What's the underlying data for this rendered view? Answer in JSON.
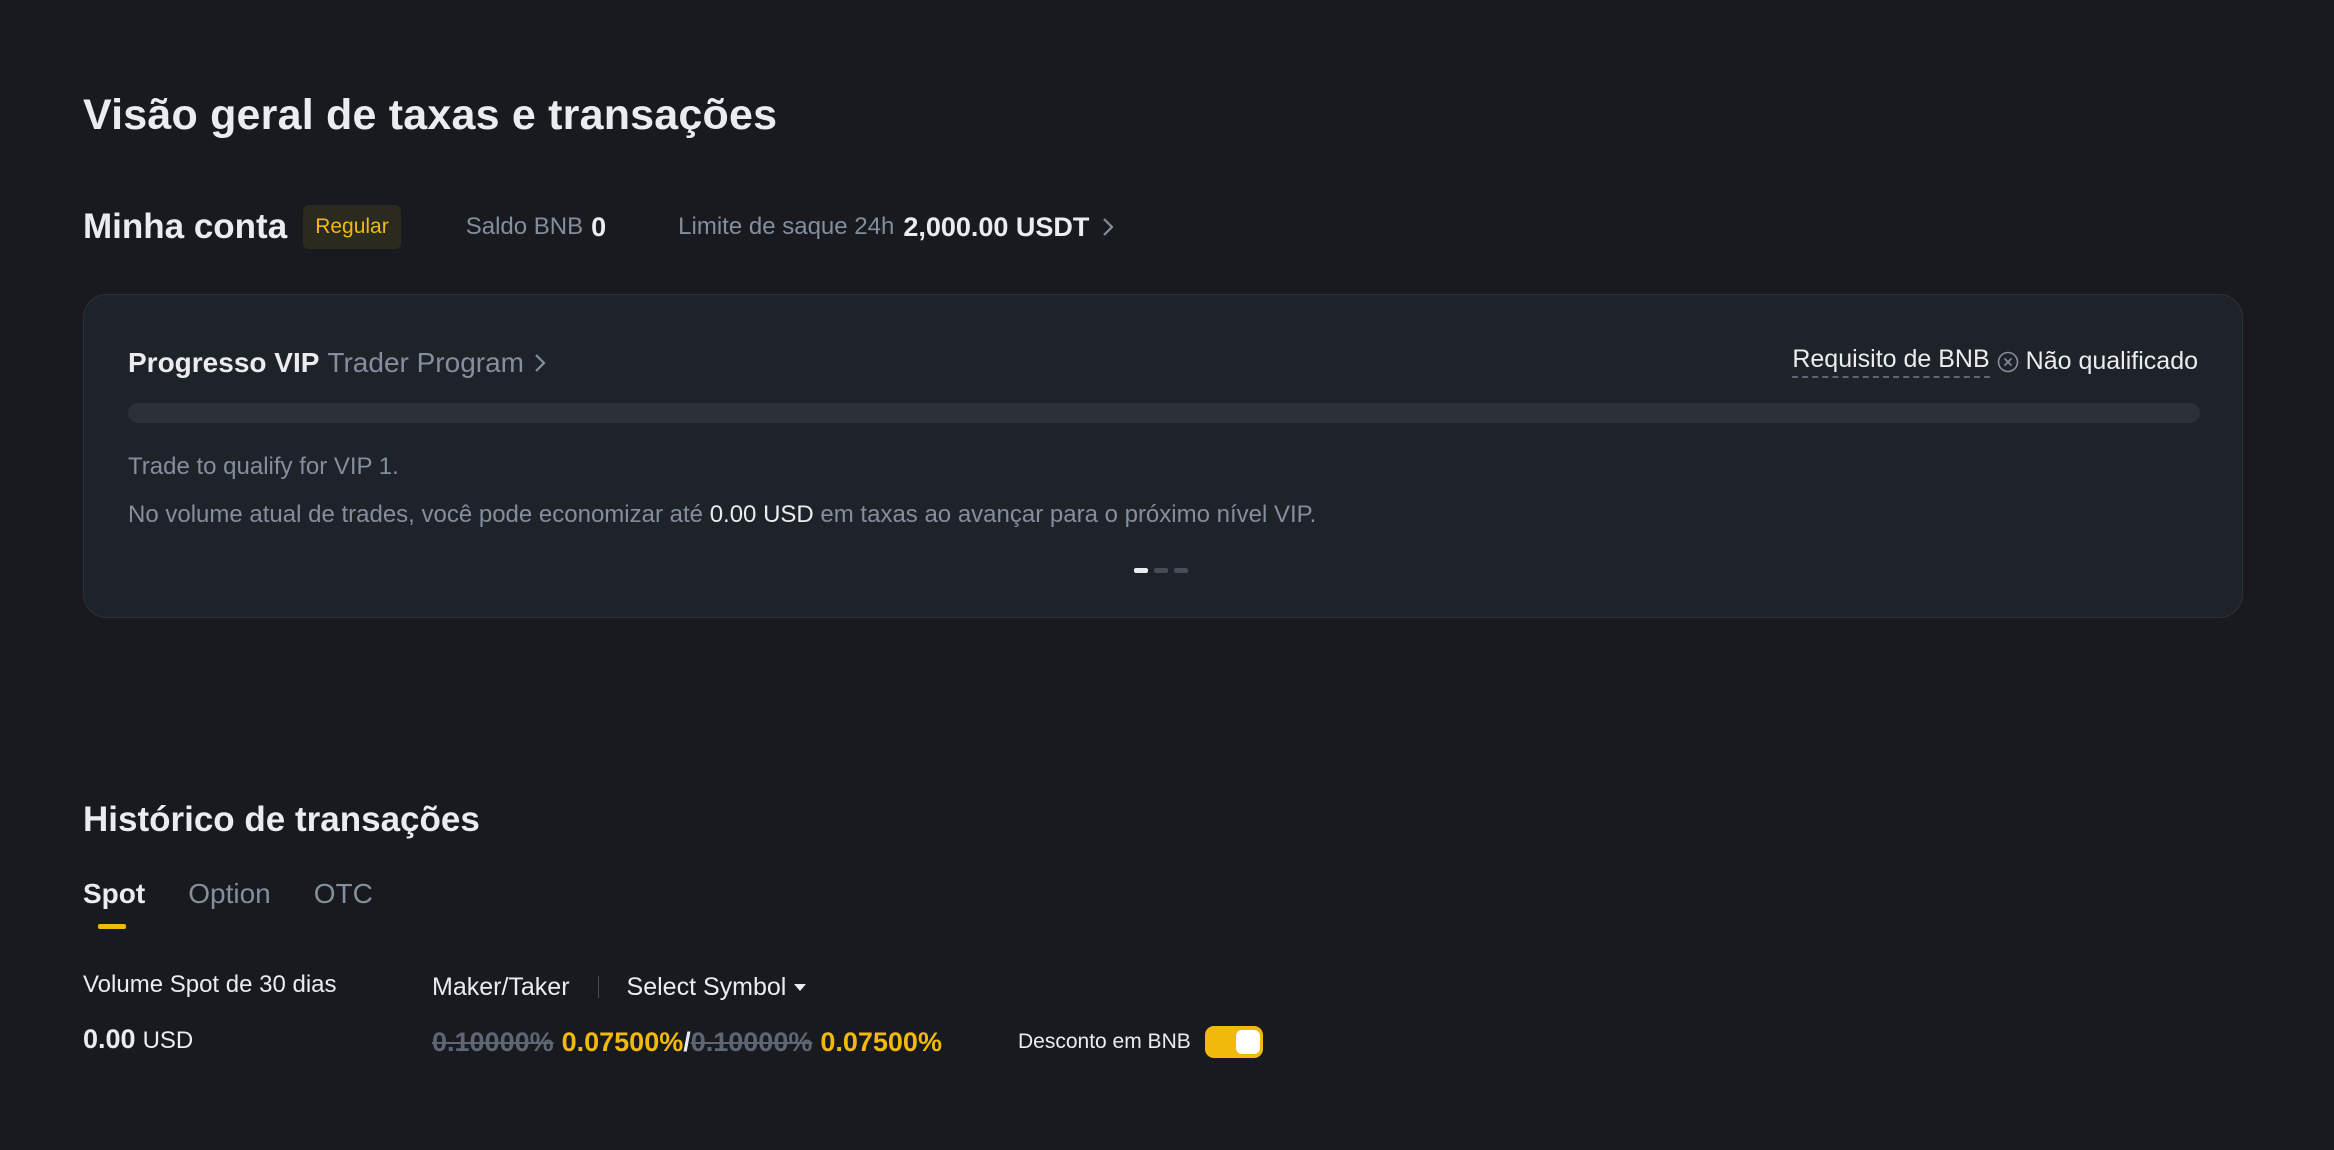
{
  "page": {
    "title": "Visão geral de taxas e transações"
  },
  "account": {
    "title": "Minha conta",
    "tier_badge": "Regular",
    "bnb_balance_label": "Saldo BNB",
    "bnb_balance_value": "0",
    "withdraw_limit_label": "Limite de saque 24h",
    "withdraw_limit_value": "2,000.00 USDT"
  },
  "vip": {
    "title": "Progresso VIP",
    "program_link": "Trader Program",
    "bnb_requirement_label": "Requisito de BNB",
    "bnb_requirement_status": "Não qualificado",
    "progress_fraction": 0,
    "line1": "Trade to qualify for VIP 1.",
    "line2_prefix": "No volume atual de trades, você pode economizar até",
    "line2_value": "0.00 USD",
    "line2_suffix": "em taxas ao avançar para o próximo nível VIP.",
    "carousel_count": 3,
    "carousel_active": 0
  },
  "history": {
    "title": "Histórico de transações",
    "tabs": [
      {
        "label": "Spot",
        "active": true
      },
      {
        "label": "Option",
        "active": false
      },
      {
        "label": "OTC",
        "active": false
      }
    ],
    "volume_label": "Volume Spot de 30 dias",
    "volume_value": "0.00",
    "volume_unit": "USD",
    "maker_taker_label": "Maker/Taker",
    "select_symbol_label": "Select Symbol",
    "maker_old": "0.10000%",
    "maker_new": "0.07500%",
    "slash": "/",
    "taker_old": "0.10000%",
    "taker_new": "0.07500%",
    "bnb_discount_label": "Desconto em BNB",
    "bnb_discount_enabled": true
  },
  "colors": {
    "background": "#181a20",
    "card": "#1e2329",
    "accent": "#f0b90b",
    "text_primary": "#eaecef",
    "text_secondary": "#848e9c"
  }
}
